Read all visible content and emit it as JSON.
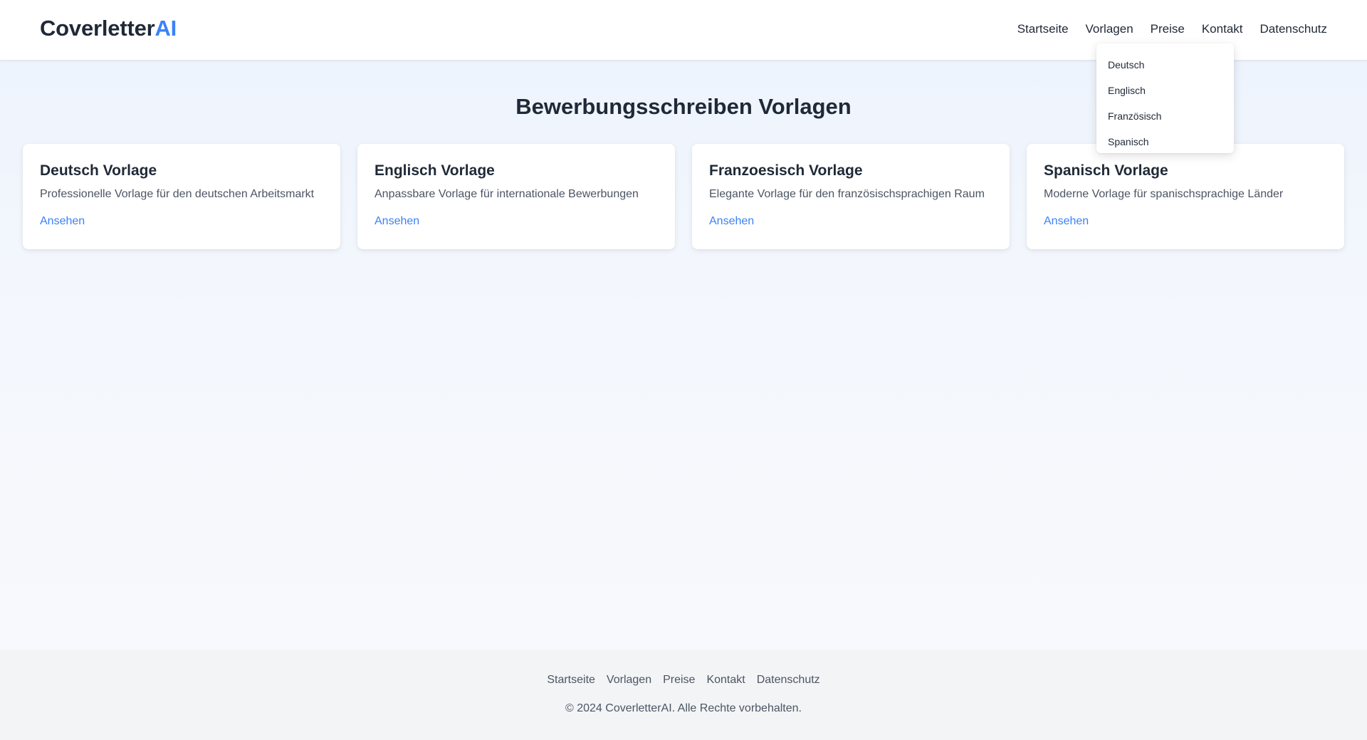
{
  "header": {
    "logo_main": "Coverletter",
    "logo_accent": "AI",
    "nav": [
      {
        "label": "Startseite"
      },
      {
        "label": "Vorlagen"
      },
      {
        "label": "Preise"
      },
      {
        "label": "Kontakt"
      },
      {
        "label": "Datenschutz"
      }
    ],
    "dropdown": {
      "parent": "Vorlagen",
      "items": [
        {
          "label": "Deutsch"
        },
        {
          "label": "Englisch"
        },
        {
          "label": "Französisch"
        },
        {
          "label": "Spanisch"
        }
      ]
    }
  },
  "main": {
    "title": "Bewerbungsschreiben Vorlagen",
    "cards": [
      {
        "title": "Deutsch Vorlage",
        "description": "Professionelle Vorlage für den deutschen Arbeitsmarkt",
        "link": "Ansehen"
      },
      {
        "title": "Englisch Vorlage",
        "description": "Anpassbare Vorlage für internationale Bewerbungen",
        "link": "Ansehen"
      },
      {
        "title": "Franzoesisch Vorlage",
        "description": "Elegante Vorlage für den französischsprachigen Raum",
        "link": "Ansehen"
      },
      {
        "title": "Spanisch Vorlage",
        "description": "Moderne Vorlage für spanischsprachige Länder",
        "link": "Ansehen"
      }
    ]
  },
  "footer": {
    "nav": [
      {
        "label": "Startseite"
      },
      {
        "label": "Vorlagen"
      },
      {
        "label": "Preise"
      },
      {
        "label": "Kontakt"
      },
      {
        "label": "Datenschutz"
      }
    ],
    "copyright": "© 2024 CoverletterAI. Alle Rechte vorbehalten."
  },
  "colors": {
    "accent": "#3b82f6",
    "text": "#1f2937",
    "muted_text": "#4b5563",
    "footer_bg": "#f3f4f6"
  }
}
